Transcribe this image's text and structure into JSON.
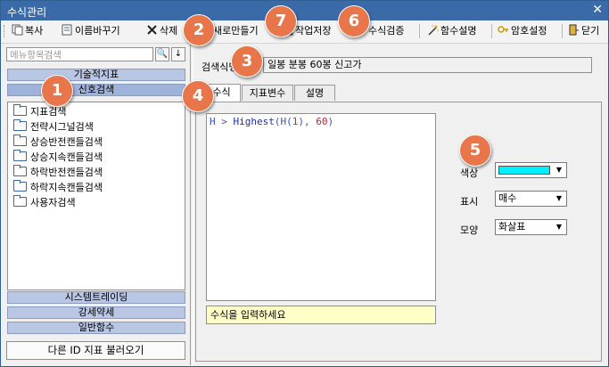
{
  "window": {
    "title": "수식관리",
    "close": "✕"
  },
  "toolbar": {
    "copy": "복사",
    "rename": "이름바꾸기",
    "delete": "삭제",
    "new": "새로만들기",
    "save": "작업저장",
    "verify": "수식검증",
    "funcs": "함수설명",
    "password": "암호설정",
    "close": "닫기"
  },
  "left": {
    "search_placeholder": "메뉴항목검색",
    "search_icon": "🔍",
    "down_icon": "↓",
    "categories_top": [
      "기술적지표",
      "신호검색"
    ],
    "tree": [
      "지표검색",
      "전략시그널검색",
      "상승반전캔들검색",
      "상승지속캔들검색",
      "하락반전캔들검색",
      "하락지속캔들검색",
      "사용자검색"
    ],
    "categories_bottom": [
      "시스템트레이딩",
      "강세약세",
      "일반함수"
    ],
    "load_button": "다른 ID 지표 불러오기"
  },
  "right": {
    "name_label": "검색식명",
    "name_value": "일봉 분봉 60봉 신고가",
    "tabs": [
      "수식",
      "지표변수",
      "설명"
    ],
    "formula": {
      "p1": "H > ",
      "fn": "Highest",
      "p2": "(H(",
      "n1": "1",
      "p3": "), ",
      "n2": "60",
      "p4": ")"
    },
    "hint": "수식을 입력하세요",
    "color_label": "색상",
    "color_value": "#00f0ff",
    "display_label": "표시",
    "display_value": "매수",
    "shape_label": "모양",
    "shape_value": "화살표"
  },
  "badges": [
    "1",
    "2",
    "3",
    "4",
    "5",
    "6",
    "7"
  ]
}
